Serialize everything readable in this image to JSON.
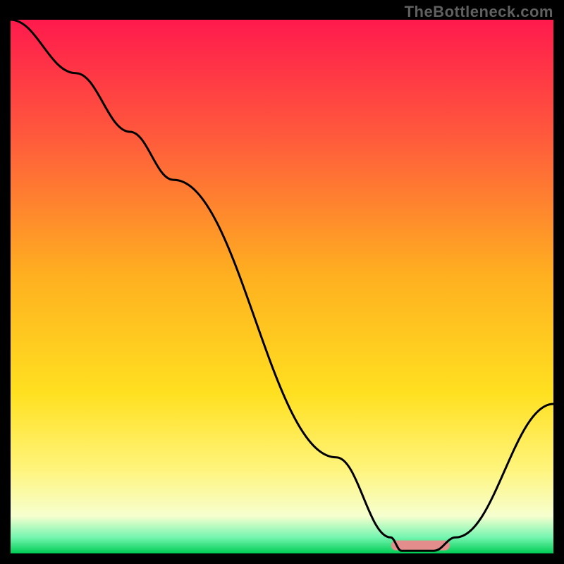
{
  "attribution": "TheBottleneck.com",
  "chart_data": {
    "type": "line",
    "title": "",
    "xlabel": "",
    "ylabel": "",
    "xlim": [
      0,
      100
    ],
    "ylim": [
      0,
      100
    ],
    "grid": false,
    "legend": false,
    "background_gradient": {
      "stops": [
        {
          "pct": 0,
          "color": "#ff1a4d"
        },
        {
          "pct": 22,
          "color": "#ff5a3c"
        },
        {
          "pct": 48,
          "color": "#ffb020"
        },
        {
          "pct": 70,
          "color": "#ffe020"
        },
        {
          "pct": 84,
          "color": "#fff47a"
        },
        {
          "pct": 93,
          "color": "#f6ffcf"
        },
        {
          "pct": 97,
          "color": "#74f5b0"
        },
        {
          "pct": 100,
          "color": "#00cc55"
        }
      ]
    },
    "series": [
      {
        "name": "curve",
        "color": "#000000",
        "x": [
          0.0,
          12.0,
          22.0,
          30.0,
          60.0,
          70.0,
          72.0,
          78.0,
          82.0,
          100.0
        ],
        "y": [
          100.0,
          90.0,
          79.0,
          70.0,
          18.0,
          3.0,
          0.5,
          0.5,
          3.0,
          28.0
        ]
      }
    ],
    "marker": {
      "name": "optimum-range",
      "x_start": 71.0,
      "x_end": 80.0,
      "y": 1.5,
      "color": "#e48d8d",
      "thickness": 14
    }
  }
}
